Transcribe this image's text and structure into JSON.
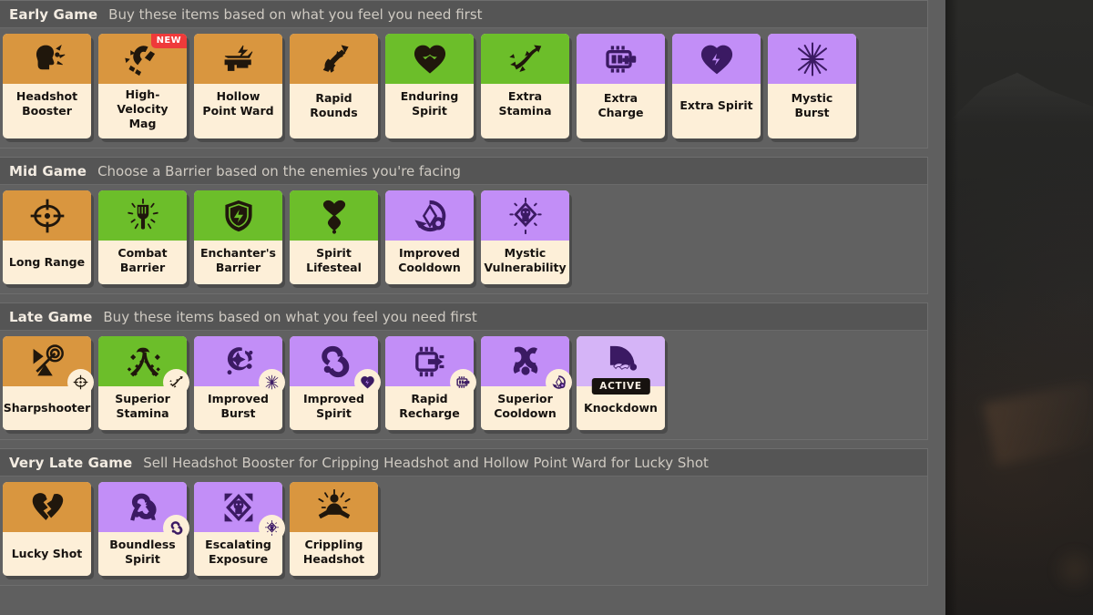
{
  "colors": {
    "panel_bg": "#5f5f5f",
    "section_bg": "#616161",
    "header_bg": "#555555",
    "card_text_bg": "#fdefd8",
    "weapon": "#d9963f",
    "vitality": "#6cbe2a",
    "spirit": "#c28ef7",
    "spirit_light": "#d5b4f7",
    "badge_new": "#ef3a3a",
    "badge_active": "#17120f",
    "backdrop": "#262626"
  },
  "sections": [
    {
      "title": "Early Game",
      "subtitle": "Buy these items based on what you feel you need first",
      "items": [
        {
          "name": "Headshot Booster",
          "type": "weapon",
          "icon": "headshot-booster-icon"
        },
        {
          "name": "High-Velocity Mag",
          "type": "weapon",
          "icon": "high-velocity-mag-icon",
          "badge": "NEW"
        },
        {
          "name": "Hollow Point Ward",
          "type": "weapon",
          "icon": "hollow-point-ward-icon"
        },
        {
          "name": "Rapid Rounds",
          "type": "weapon",
          "icon": "rapid-rounds-icon"
        },
        {
          "name": "Enduring Spirit",
          "type": "vitality",
          "icon": "enduring-spirit-icon"
        },
        {
          "name": "Extra Stamina",
          "type": "vitality",
          "icon": "extra-stamina-icon"
        },
        {
          "name": "Extra Charge",
          "type": "spirit",
          "icon": "extra-charge-icon"
        },
        {
          "name": "Extra Spirit",
          "type": "spirit",
          "icon": "extra-spirit-icon"
        },
        {
          "name": "Mystic Burst",
          "type": "spirit",
          "icon": "mystic-burst-icon"
        }
      ]
    },
    {
      "title": "Mid Game",
      "subtitle": "Choose a Barrier based on the enemies you're facing",
      "items": [
        {
          "name": "Long Range",
          "type": "weapon",
          "icon": "long-range-icon"
        },
        {
          "name": "Combat Barrier",
          "type": "vitality",
          "icon": "combat-barrier-icon"
        },
        {
          "name": "Enchanter's Barrier",
          "type": "vitality",
          "icon": "enchanters-barrier-icon"
        },
        {
          "name": "Spirit Lifesteal",
          "type": "vitality",
          "icon": "spirit-lifesteal-icon"
        },
        {
          "name": "Improved Cooldown",
          "type": "spirit",
          "icon": "improved-cooldown-icon"
        },
        {
          "name": "Mystic Vulnerability",
          "type": "spirit",
          "icon": "mystic-vulnerability-icon"
        }
      ]
    },
    {
      "title": "Late Game",
      "subtitle": "Buy these items based on what you feel you need first",
      "items": [
        {
          "name": "Sharpshooter",
          "type": "weapon",
          "icon": "sharpshooter-icon",
          "component": "long-range-icon",
          "component_type": "weapon"
        },
        {
          "name": "Superior Stamina",
          "type": "vitality",
          "icon": "superior-stamina-icon",
          "component": "extra-stamina-icon",
          "component_type": "vitality"
        },
        {
          "name": "Improved Burst",
          "type": "spirit",
          "icon": "improved-burst-icon",
          "component": "mystic-burst-icon",
          "component_type": "spirit"
        },
        {
          "name": "Improved Spirit",
          "type": "spirit",
          "icon": "improved-spirit-icon",
          "component": "extra-spirit-icon",
          "component_type": "spirit"
        },
        {
          "name": "Rapid Recharge",
          "type": "spirit",
          "icon": "rapid-recharge-icon",
          "component": "extra-charge-icon",
          "component_type": "spirit"
        },
        {
          "name": "Superior Cooldown",
          "type": "spirit",
          "icon": "superior-cooldown-icon",
          "component": "improved-cooldown-icon",
          "component_type": "spirit"
        },
        {
          "name": "Knockdown",
          "type": "spirit-light",
          "icon": "knockdown-icon",
          "badge": "ACTIVE"
        }
      ]
    },
    {
      "title": "Very Late Game",
      "subtitle": "Sell Headshot Booster for Cripping Headshot and Hollow Point Ward for Lucky Shot",
      "items": [
        {
          "name": "Lucky Shot",
          "type": "weapon",
          "icon": "lucky-shot-icon"
        },
        {
          "name": "Boundless Spirit",
          "type": "spirit",
          "icon": "boundless-spirit-icon",
          "component": "improved-spirit-icon",
          "component_type": "spirit"
        },
        {
          "name": "Escalating Exposure",
          "type": "spirit",
          "icon": "escalating-exposure-icon",
          "component": "mystic-vulnerability-icon",
          "component_type": "spirit"
        },
        {
          "name": "Crippling Headshot",
          "type": "weapon",
          "icon": "crippling-headshot-icon"
        }
      ]
    }
  ]
}
